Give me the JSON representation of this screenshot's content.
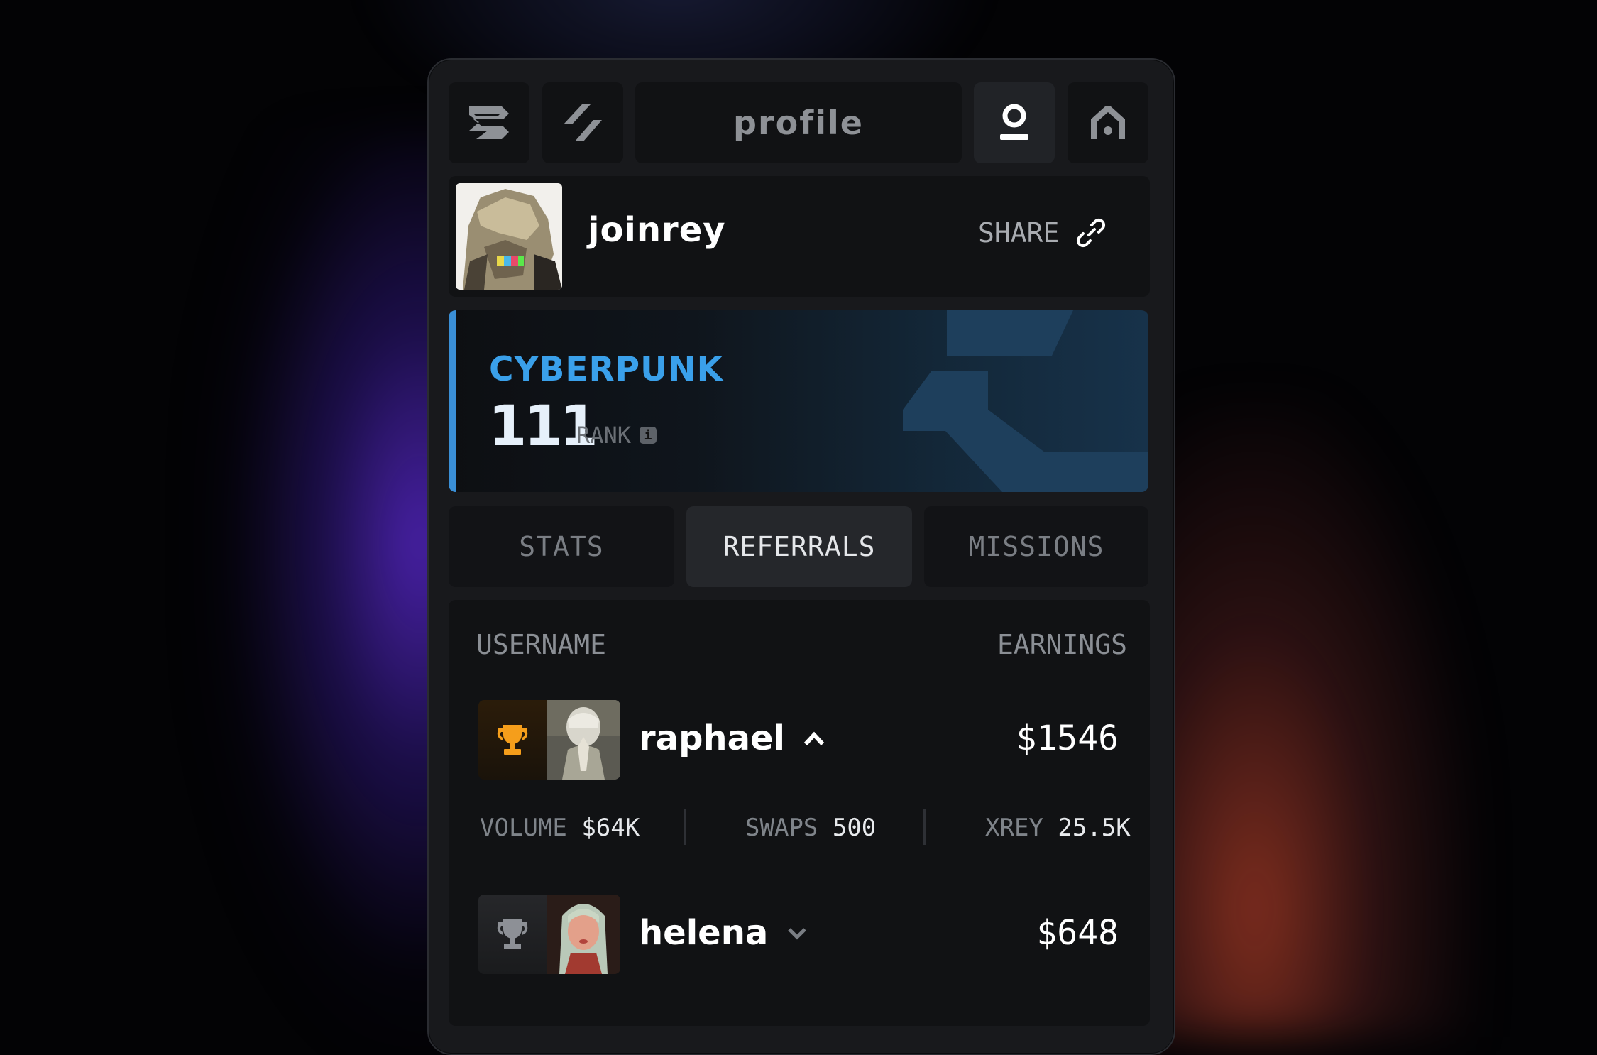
{
  "nav": {
    "title": "profile",
    "icons": [
      "logo-icon",
      "bolt-icon",
      "user-icon",
      "home-icon"
    ]
  },
  "profile": {
    "username": "joinrey",
    "share_label": "SHARE"
  },
  "rank": {
    "tier": "CYBERPUNK",
    "value": "111",
    "label": "RANK",
    "accent_color": "#3a8fd6",
    "tier_color": "#3aa0ea"
  },
  "tabs": [
    {
      "label": "STATS",
      "active": false
    },
    {
      "label": "REFERRALS",
      "active": true
    },
    {
      "label": "MISSIONS",
      "active": false
    }
  ],
  "table": {
    "headers": {
      "username": "USERNAME",
      "earnings": "EARNINGS"
    },
    "rows": [
      {
        "name": "raphael",
        "earnings": "$1546",
        "expanded": true,
        "trophy_color": "#f59e1b",
        "stats": [
          {
            "label": "VOLUME",
            "value": "$64K"
          },
          {
            "label": "SWAPS",
            "value": "500"
          },
          {
            "label": "XREY",
            "value": "25.5K"
          }
        ]
      },
      {
        "name": "helena",
        "earnings": "$648",
        "expanded": false,
        "trophy_color": "#8d9096"
      }
    ]
  }
}
